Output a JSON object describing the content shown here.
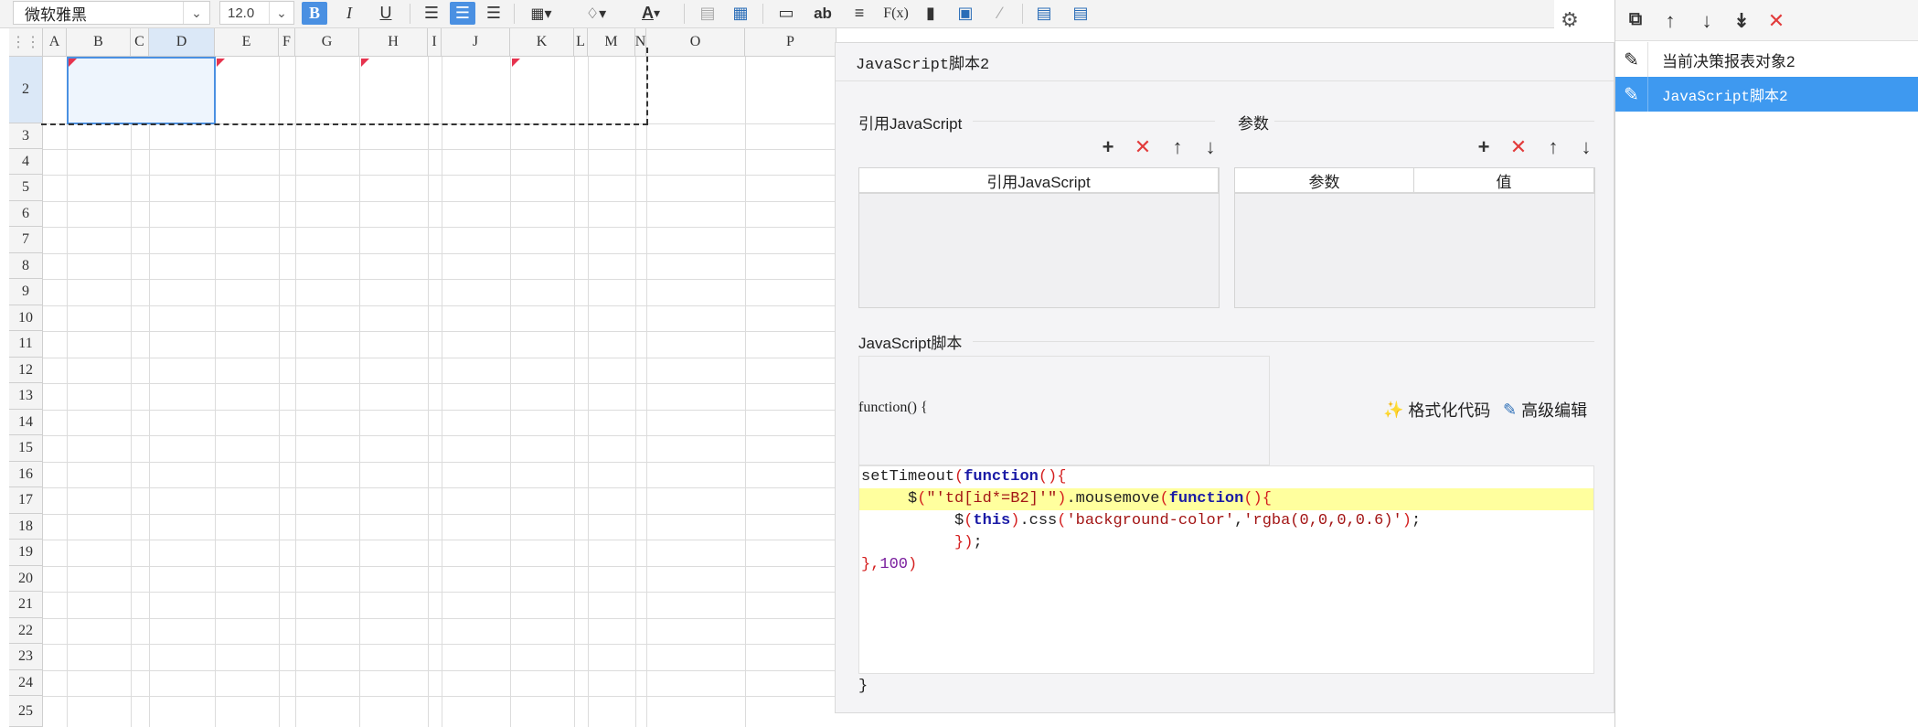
{
  "toolbar": {
    "font_name": "微软雅黑",
    "font_size": "12.0",
    "bold": "B",
    "italic": "I",
    "underline": "U",
    "text_label": "ab",
    "formula_label": "F(x)",
    "font_color_label": "A"
  },
  "sheet": {
    "columns": [
      "A",
      "B",
      "C",
      "D",
      "E",
      "F",
      "G",
      "H",
      "I",
      "J",
      "K",
      "L",
      "M",
      "N",
      "O",
      "P"
    ],
    "rows": [
      "2",
      "3",
      "4",
      "5",
      "6",
      "7",
      "8",
      "9",
      "10",
      "11",
      "12",
      "13",
      "14",
      "15",
      "16",
      "17",
      "18",
      "19",
      "20",
      "21",
      "22",
      "23",
      "24",
      "25"
    ],
    "selected_col": "D",
    "selected_row": "2"
  },
  "dialog": {
    "title": "JavaScript脚本2",
    "ref_js_section": "引用JavaScript",
    "params_section": "参数",
    "ref_js_column": "引用JavaScript",
    "param_column": "参数",
    "value_column": "值",
    "script_section": "JavaScript脚本",
    "function_header": "function() {",
    "format_code_label": "格式化代码",
    "advanced_edit_label": "高级编辑",
    "closing_brace": "}",
    "code_lines": [
      {
        "parts": [
          [
            "plain",
            "setTimeout"
          ],
          [
            "pn",
            "("
          ],
          [
            "kw",
            "function"
          ],
          [
            "pn",
            "(){"
          ]
        ]
      },
      {
        "hl": true,
        "parts": [
          [
            "plain",
            "     $"
          ],
          [
            "pn",
            "("
          ],
          [
            "st",
            "\"'td[id*=B2]'\""
          ],
          [
            "pn",
            ")"
          ],
          [
            "plain",
            ".mousemove"
          ],
          [
            "pn",
            "("
          ],
          [
            "kw",
            "function"
          ],
          [
            "pn",
            "(){"
          ]
        ]
      },
      {
        "parts": [
          [
            "plain",
            "          $"
          ],
          [
            "pn",
            "("
          ],
          [
            "kw",
            "this"
          ],
          [
            "pn",
            ")"
          ],
          [
            "plain",
            ".css"
          ],
          [
            "pn",
            "("
          ],
          [
            "st",
            "'background-color'"
          ],
          [
            "plain",
            ","
          ],
          [
            "st",
            "'rgba(0,0,0,0.6)'"
          ],
          [
            "pn",
            ")"
          ],
          [
            "plain",
            ";"
          ]
        ]
      },
      {
        "parts": [
          [
            "plain",
            "          "
          ],
          [
            "pn",
            "})"
          ],
          [
            "plain",
            ";"
          ]
        ]
      },
      {
        "parts": [
          [
            "pn",
            "},"
          ],
          [
            "nm",
            "100"
          ],
          [
            "pn",
            ")"
          ]
        ]
      }
    ]
  },
  "tree": {
    "items": [
      {
        "label": "当前决策报表对象2",
        "selected": false
      },
      {
        "label": "JavaScript脚本2",
        "selected": true
      }
    ]
  },
  "colors": {
    "accent": "#4a90e2",
    "selection": "#3e99f0",
    "delete": "#e23b3b"
  }
}
